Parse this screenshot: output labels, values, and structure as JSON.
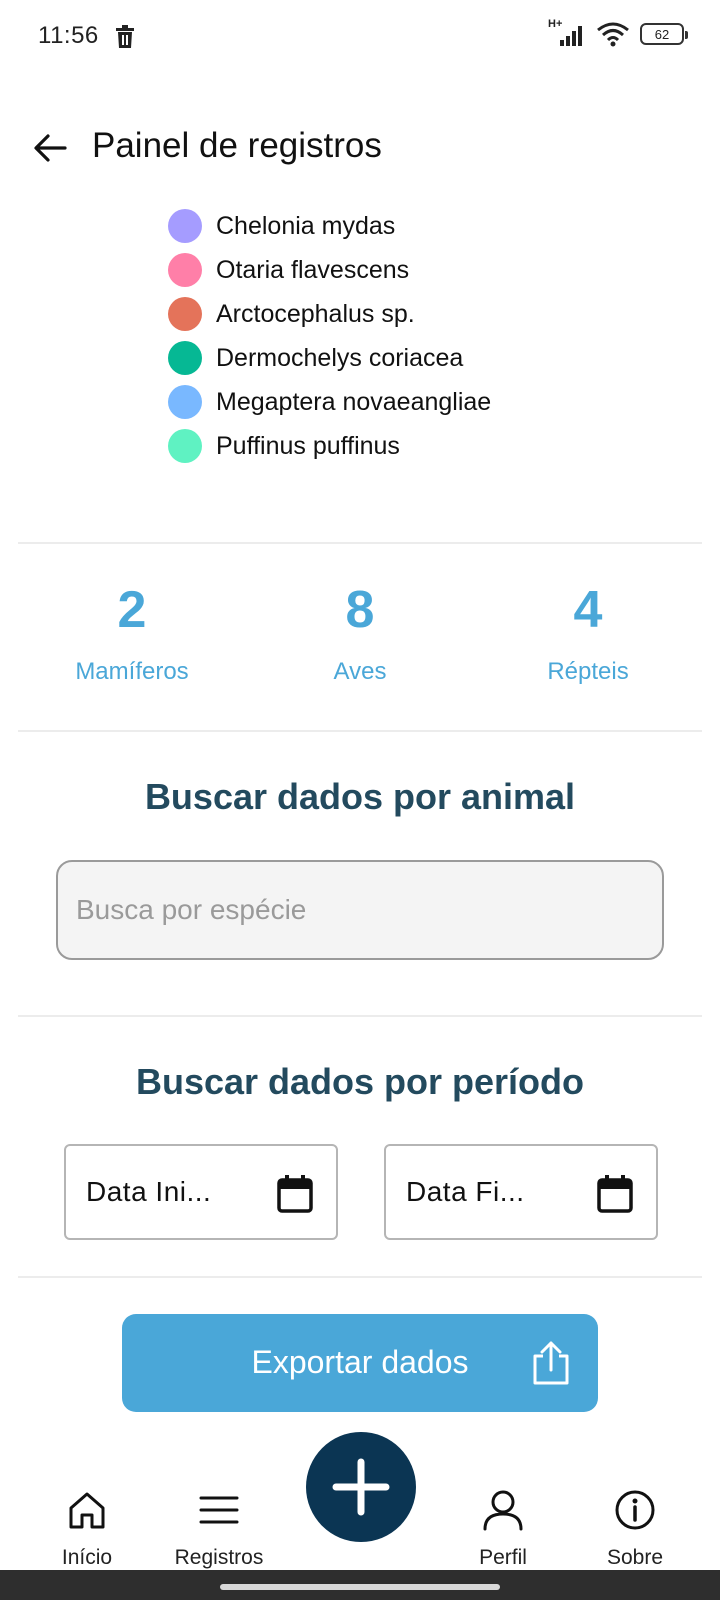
{
  "status_bar": {
    "time": "11:56",
    "network": "H+",
    "battery": "62"
  },
  "header": {
    "title": "Painel de registros"
  },
  "legend": {
    "items": [
      {
        "label": "Chelonia mydas",
        "color": "#a59cff"
      },
      {
        "label": "Otaria flavescens",
        "color": "#ff7fa8"
      },
      {
        "label": "Arctocephalus sp.",
        "color": "#e4735a"
      },
      {
        "label": "Dermochelys coriacea",
        "color": "#06b894"
      },
      {
        "label": "Megaptera novaeangliae",
        "color": "#79b8ff"
      },
      {
        "label": "Puffinus puffinus",
        "color": "#5ff2c2"
      }
    ]
  },
  "stats": {
    "mammals": {
      "value": "2",
      "label": "Mamíferos"
    },
    "birds": {
      "value": "8",
      "label": "Aves"
    },
    "reptiles": {
      "value": "4",
      "label": "Répteis"
    }
  },
  "search_animal": {
    "title": "Buscar dados por animal",
    "placeholder": "Busca por espécie",
    "value": ""
  },
  "search_period": {
    "title": "Buscar dados por período",
    "start_label": "Data Ini...",
    "end_label": "Data Fi..."
  },
  "export": {
    "label": "Exportar dados"
  },
  "nav": {
    "home": "Início",
    "records": "Registros",
    "profile": "Perfil",
    "about": "Sobre"
  },
  "colors": {
    "accent": "#4aa7d8",
    "heading": "#234a5e",
    "fab": "#0b3553"
  }
}
